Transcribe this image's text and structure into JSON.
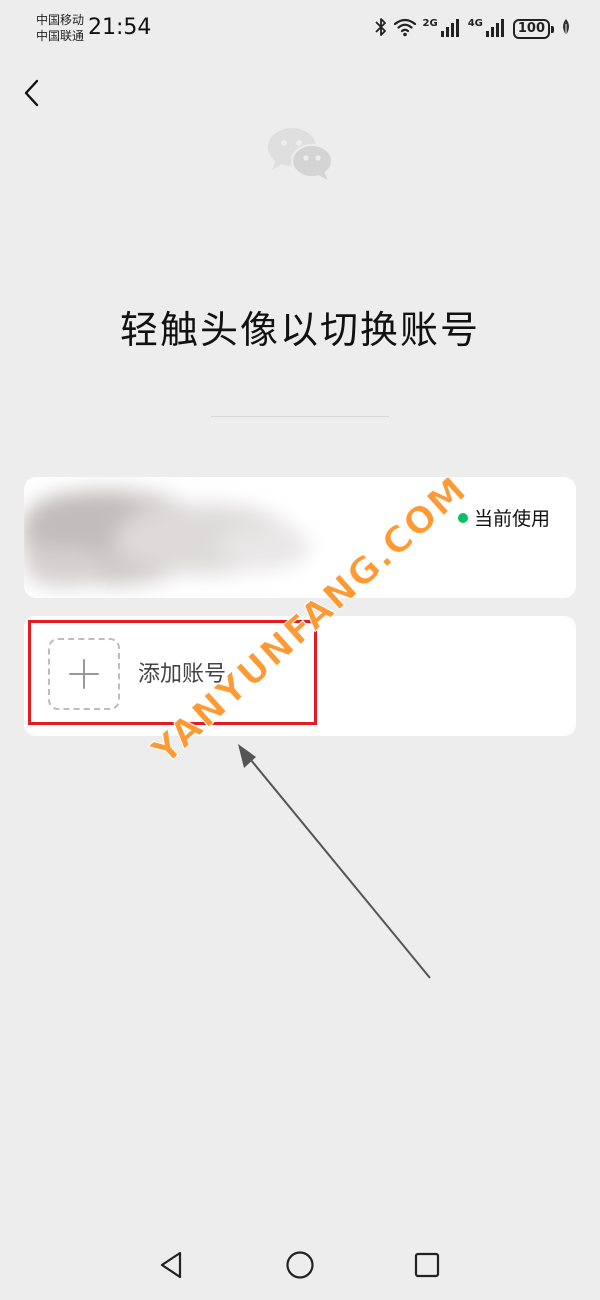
{
  "status_bar": {
    "carrier1": "中国移动",
    "carrier2": "中国联通",
    "time": "21:54",
    "network1": "2G",
    "network2": "4G",
    "battery": "100"
  },
  "header": {
    "back_icon": "chevron-left-icon",
    "logo_icon": "wechat-logo-icon"
  },
  "main": {
    "title": "轻触头像以切换账号",
    "accounts": [
      {
        "status_label": "当前使用",
        "status_color": "#07c160"
      }
    ],
    "add_account_label": "添加账号"
  },
  "watermark": "YANYUNFANG.COM",
  "colors": {
    "background": "#ededed",
    "accent_green": "#07c160",
    "annotation_red": "#e31b23",
    "watermark_orange": "#ff9933"
  },
  "nav_bar": {
    "icons": [
      "triangle-back-icon",
      "circle-home-icon",
      "square-recent-icon"
    ]
  }
}
